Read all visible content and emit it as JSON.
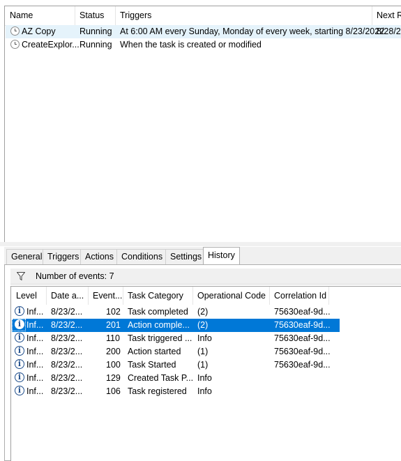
{
  "tasks": {
    "columns": [
      "Name",
      "Status",
      "Triggers",
      "Next R"
    ],
    "rows": [
      {
        "name": "AZ Copy",
        "status": "Running",
        "triggers": "At 6:00 AM every Sunday, Monday of every week, starting 8/23/2022",
        "next": "8/28/2"
      },
      {
        "name": "CreateExplor...",
        "status": "Running",
        "triggers": "When the task is created or modified",
        "next": ""
      }
    ]
  },
  "tabs": [
    "General",
    "Triggers",
    "Actions",
    "Conditions",
    "Settings",
    "History"
  ],
  "active_tab": "History",
  "history": {
    "events_label": "Number of events: 7",
    "columns": [
      "Level",
      "Date a...",
      "Event...",
      "Task Category",
      "Operational Code",
      "Correlation Id"
    ],
    "rows": [
      {
        "level": "Inf...",
        "date": "8/23/2...",
        "event": "102",
        "category": "Task completed",
        "opcode": "(2)",
        "corr": "75630eaf-9d..."
      },
      {
        "level": "Inf...",
        "date": "8/23/2...",
        "event": "201",
        "category": "Action comple...",
        "opcode": "(2)",
        "corr": "75630eaf-9d..."
      },
      {
        "level": "Inf...",
        "date": "8/23/2...",
        "event": "110",
        "category": "Task triggered ...",
        "opcode": "Info",
        "corr": "75630eaf-9d..."
      },
      {
        "level": "Inf...",
        "date": "8/23/2...",
        "event": "200",
        "category": "Action started",
        "opcode": "(1)",
        "corr": "75630eaf-9d..."
      },
      {
        "level": "Inf...",
        "date": "8/23/2...",
        "event": "100",
        "category": "Task Started",
        "opcode": "(1)",
        "corr": "75630eaf-9d..."
      },
      {
        "level": "Inf...",
        "date": "8/23/2...",
        "event": "129",
        "category": "Created Task P...",
        "opcode": "Info",
        "corr": ""
      },
      {
        "level": "Inf...",
        "date": "8/23/2...",
        "event": "106",
        "category": "Task registered",
        "opcode": "Info",
        "corr": ""
      }
    ],
    "selected_index": 1
  },
  "icons": {
    "task": "clock-icon",
    "level": "info-icon",
    "filter": "filter-icon"
  },
  "colors": {
    "selection": "#0078d7",
    "row_highlight": "#e5f3fb",
    "chrome": "#f0f0f0"
  }
}
